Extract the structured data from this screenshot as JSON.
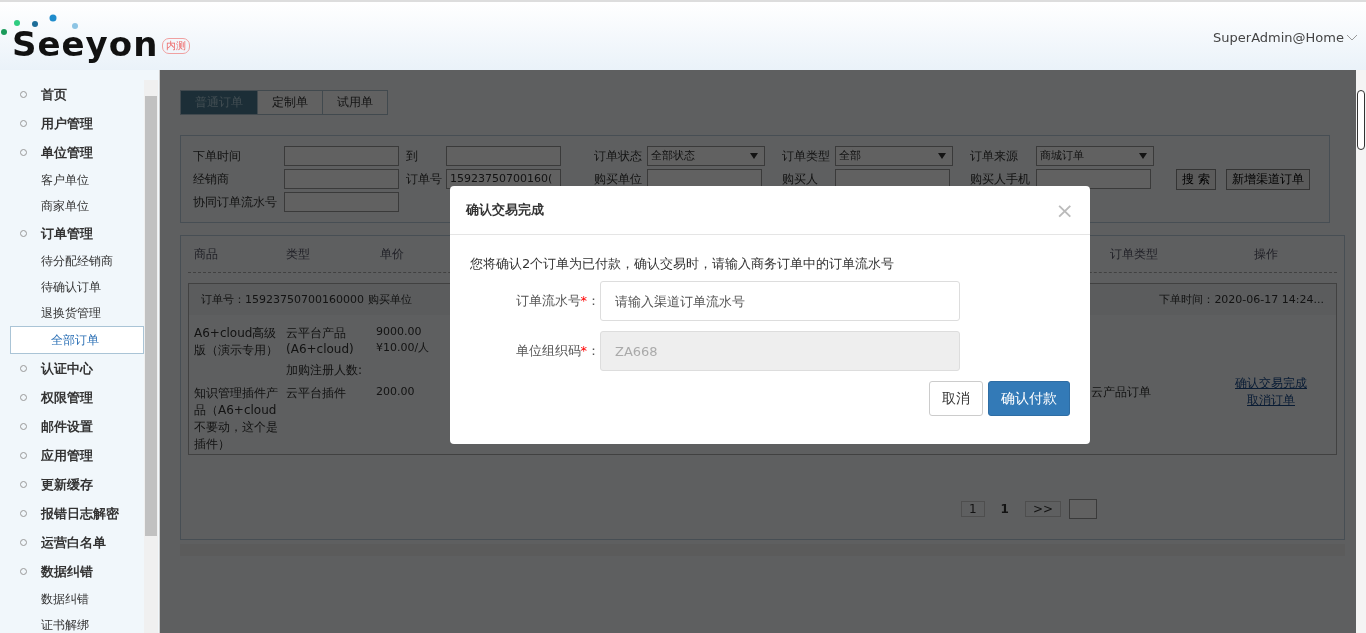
{
  "header": {
    "logo_text": "Seeyon",
    "logo_badge": "内测",
    "user": "SuperAdmin@Home"
  },
  "sidebar": {
    "items": [
      {
        "label": "首页",
        "selected": false
      },
      {
        "label": "用户管理",
        "selected": false
      },
      {
        "label": "单位管理",
        "selected": false,
        "children": [
          {
            "label": "客户单位",
            "selected": false
          },
          {
            "label": "商家单位",
            "selected": false
          }
        ]
      },
      {
        "label": "订单管理",
        "selected": false,
        "children": [
          {
            "label": "待分配经销商",
            "selected": false
          },
          {
            "label": "待确认订单",
            "selected": false
          },
          {
            "label": "退换货管理",
            "selected": false
          },
          {
            "label": "全部订单",
            "selected": true
          }
        ]
      },
      {
        "label": "认证中心",
        "selected": false
      },
      {
        "label": "权限管理",
        "selected": false
      },
      {
        "label": "邮件设置",
        "selected": false
      },
      {
        "label": "应用管理",
        "selected": false
      },
      {
        "label": "更新缓存",
        "selected": false
      },
      {
        "label": "报错日志解密",
        "selected": false
      },
      {
        "label": "运营白名单",
        "selected": false
      },
      {
        "label": "数据纠错",
        "selected": false,
        "children": [
          {
            "label": "数据纠错",
            "selected": false
          },
          {
            "label": "证书解绑",
            "selected": false
          }
        ]
      }
    ]
  },
  "tabs": [
    {
      "label": "普通订单",
      "selected": true
    },
    {
      "label": "定制单",
      "selected": false
    },
    {
      "label": "试用单",
      "selected": false
    }
  ],
  "filters": {
    "rows": [
      [
        {
          "label": "下单时间",
          "kind": "text"
        },
        {
          "label": "到",
          "kind": "text"
        },
        {
          "label": "订单状态",
          "kind": "select",
          "value": "全部状态"
        },
        {
          "label": "订单类型",
          "kind": "select",
          "value": "全部"
        },
        {
          "label": "订单来源",
          "kind": "select",
          "value": "商城订单"
        }
      ],
      [
        {
          "label": "经销商",
          "kind": "text"
        },
        {
          "label": "订单号",
          "kind": "text",
          "value": "15923750700160("
        },
        {
          "label": "购买单位",
          "kind": "text"
        },
        {
          "label": "购买人",
          "kind": "text"
        },
        {
          "label": "购买人手机",
          "kind": "text"
        }
      ],
      [
        {
          "label": "协同订单流水号",
          "kind": "text"
        }
      ]
    ],
    "buttons": [
      "搜 索",
      "新增渠道订单"
    ]
  },
  "table": {
    "columns": [
      "商品",
      "类型",
      "单价",
      "订单类型",
      "操作"
    ],
    "order": {
      "order_no": "订单号：15923750700160000",
      "buyer": "购买单位",
      "time": "下单时间：2020-06-17 14:24...",
      "items": [
        {
          "product": "A6+cloud高级版（演示专用）",
          "type": "云平台产品(A6+cloud)",
          "price": "9000.00",
          "extra": [
            "¥10.00/人",
            "加购注册人数:"
          ]
        },
        {
          "product": "知识管理插件产品（A6+cloud不要动，这个是插件）",
          "type": "云平台插件",
          "price": "200.00"
        }
      ],
      "order_type": "云产品订单",
      "actions": [
        "确认交易完成",
        "取消订单"
      ]
    }
  },
  "pagination": {
    "pages": [
      {
        "label": "1",
        "current": false
      },
      {
        "label": "1",
        "current": true
      },
      {
        "label": ">>",
        "current": false
      }
    ]
  },
  "dialog": {
    "title": "确认交易完成",
    "close": "×",
    "message": "您将确认2个订单为已付款，确认交易时，请输入商务订单中的订单流水号",
    "fields": [
      {
        "label": "订单流水号",
        "required_mark": "*",
        "suffix": "：",
        "placeholder": "请输入渠道订单流水号",
        "disabled": false
      },
      {
        "label": "单位组织码",
        "required_mark": "*",
        "suffix": "：",
        "value": "ZA668",
        "disabled": true
      }
    ],
    "buttons": [
      {
        "label": "取消",
        "kind": "default"
      },
      {
        "label": "确认付款",
        "kind": "primary"
      }
    ]
  }
}
